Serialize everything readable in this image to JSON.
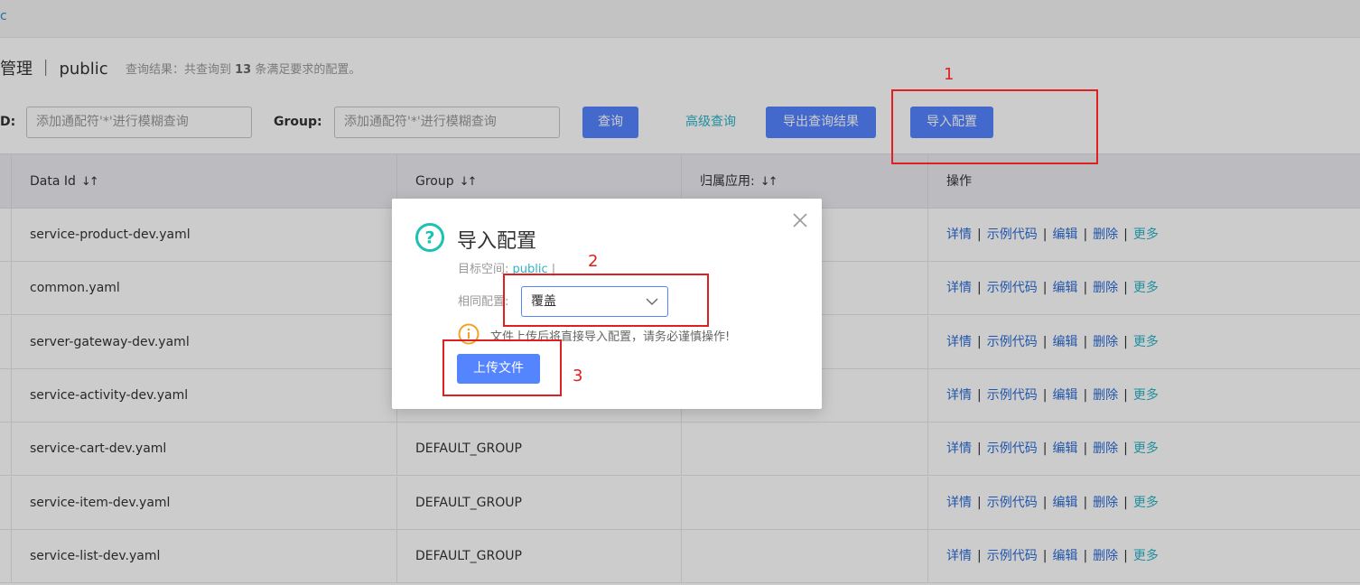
{
  "topbar": {
    "crumb": "c"
  },
  "header": {
    "title": "管理 ｜ public",
    "result_prefix": "查询结果：共查询到 ",
    "result_count": "13",
    "result_suffix": " 条满足要求的配置。"
  },
  "search": {
    "dataid_label": "D:",
    "dataid_placeholder": "添加通配符'*'进行模糊查询",
    "group_label": "Group:",
    "group_placeholder": "添加通配符'*'进行模糊查询",
    "query_button": "查询",
    "advanced_query": "高级查询",
    "export_button": "导出查询结果",
    "import_button": "导入配置"
  },
  "table": {
    "columns": [
      "Data Id",
      "Group",
      "归属应用:",
      "操作"
    ],
    "rows": [
      {
        "data_id": "service-product-dev.yaml",
        "group": ""
      },
      {
        "data_id": "common.yaml",
        "group": ""
      },
      {
        "data_id": "server-gateway-dev.yaml",
        "group": ""
      },
      {
        "data_id": "service-activity-dev.yaml",
        "group": ""
      },
      {
        "data_id": "service-cart-dev.yaml",
        "group": "DEFAULT_GROUP"
      },
      {
        "data_id": "service-item-dev.yaml",
        "group": "DEFAULT_GROUP"
      },
      {
        "data_id": "service-list-dev.yaml",
        "group": "DEFAULT_GROUP"
      }
    ],
    "actions": [
      "详情",
      "示例代码",
      "编辑",
      "删除",
      "更多"
    ]
  },
  "dialog": {
    "title": "导入配置",
    "namespace_label": "目标空间:",
    "namespace_value": "public",
    "namespace_sep": "|",
    "same_config_label": "相同配置:",
    "same_config_value": "覆盖",
    "warning": "文件上传后将直接导入配置，请务必谨慎操作!",
    "upload_button": "上传文件"
  },
  "annotations": {
    "n1": "1",
    "n2": "2",
    "n3": "3"
  },
  "colors": {
    "primary": "#5584ff",
    "link": "#2bb3c6",
    "annotation": "#e02020",
    "warning": "#f1a325",
    "help": "#1dc1b3"
  }
}
